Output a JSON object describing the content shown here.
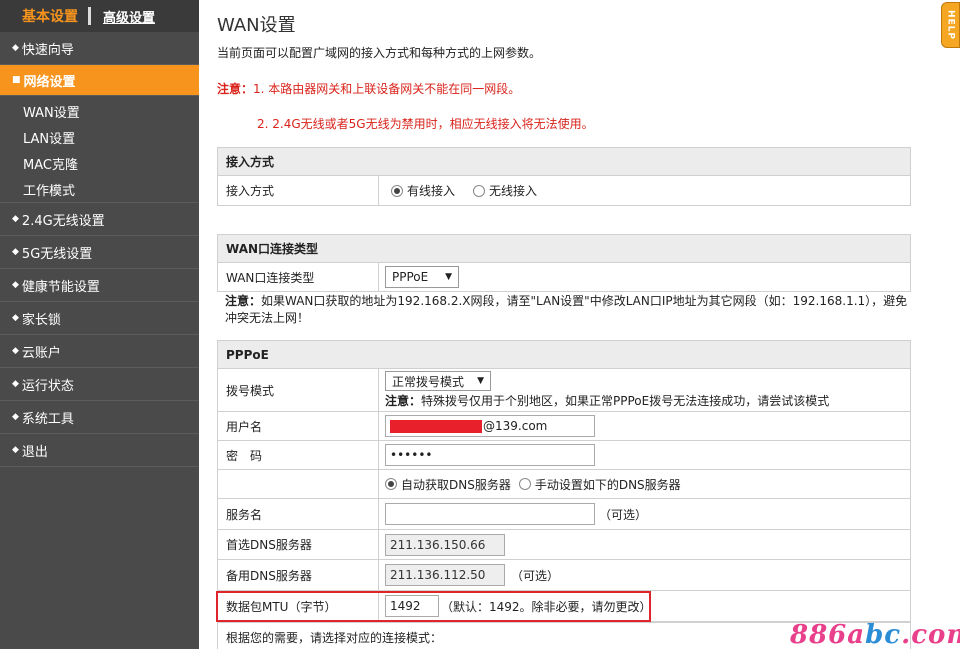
{
  "sidebar": {
    "tab_basic": "基本设置",
    "tab_advanced": "高级设置",
    "items": [
      {
        "label": "快速向导"
      },
      {
        "label": "网络设置"
      },
      {
        "label": "2.4G无线设置"
      },
      {
        "label": "5G无线设置"
      },
      {
        "label": "健康节能设置"
      },
      {
        "label": "家长锁"
      },
      {
        "label": "云账户"
      },
      {
        "label": "运行状态"
      },
      {
        "label": "系统工具"
      },
      {
        "label": "退出"
      }
    ],
    "sub_items": [
      {
        "label": "WAN设置"
      },
      {
        "label": "LAN设置"
      },
      {
        "label": "MAC克隆"
      },
      {
        "label": "工作模式"
      }
    ]
  },
  "main": {
    "title": "WAN设置",
    "description": "当前页面可以配置广域网的接入方式和每种方式的上网参数。",
    "notice_prefix": "注意：",
    "notice_1": "1. 本路由器网关和上联设备网关不能在同一网段。",
    "notice_2": "2. 2.4G无线或者5G无线为禁用时，相应无线接入将无法使用。",
    "help": "HELP",
    "access": {
      "header": "接入方式",
      "label": "接入方式",
      "opt_wired": "有线接入",
      "opt_wireless": "无线接入"
    },
    "wan_type": {
      "header": "WAN口连接类型",
      "label": "WAN口连接类型",
      "value": "PPPoE",
      "note_prefix": "注意：",
      "note": "如果WAN口获取的地址为192.168.2.X网段，请至\"LAN设置\"中修改LAN口IP地址为其它网段（如：192.168.1.1），避免冲突无法上网！"
    },
    "pppoe": {
      "header": "PPPoE",
      "dial_label": "拨号模式",
      "dial_value": "正常拨号模式",
      "dial_note_prefix": "注意：",
      "dial_note": "特殊拨号仅用于个别地区，如果正常PPPoE拨号无法连接成功，请尝试该模式",
      "user_label": "用户名",
      "user_suffix": "@139.com",
      "pass_label": "密　码",
      "pass_value": "••••••",
      "dns_auto": "自动获取DNS服务器",
      "dns_manual": "手动设置如下的DNS服务器",
      "service_label": "服务名",
      "service_value": "",
      "optional": "（可选）",
      "dns1_label": "首选DNS服务器",
      "dns1_value": "211.136.150.66",
      "dns2_label": "备用DNS服务器",
      "dns2_value": "211.136.112.50",
      "mtu_label": "数据包MTU（字节）",
      "mtu_value": "1492",
      "mtu_note": "（默认：1492。除非必要，请勿更改）",
      "bottom_line": "根据您的需要，请选择对应的连接模式："
    }
  },
  "watermark": {
    "a": "886a",
    "b": "bc",
    "c": ".com"
  }
}
